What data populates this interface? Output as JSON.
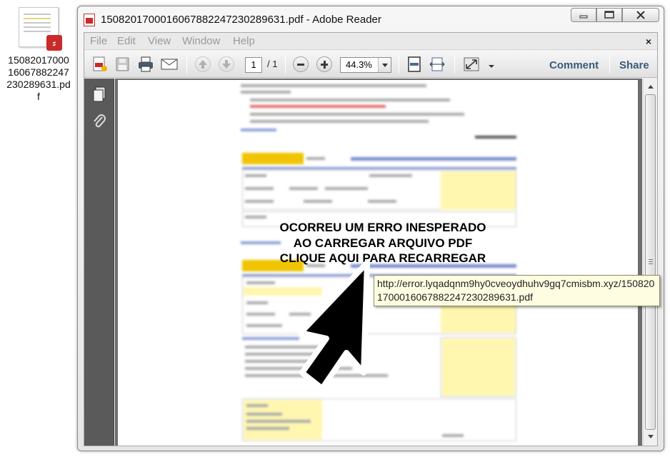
{
  "desktop": {
    "icon_label": "1508201700016067882247230289631.pdf",
    "icon_name": "pdf-file-icon"
  },
  "window": {
    "title": "1508201700016067882247230289631.pdf - Adobe Reader",
    "controls": {
      "minimize_icon": "minimize-icon",
      "maximize_icon": "maximize-icon",
      "close_icon": "close-icon"
    }
  },
  "menubar": {
    "items": [
      "File",
      "Edit",
      "View",
      "Window",
      "Help"
    ],
    "close_glyph": "×"
  },
  "toolbar": {
    "current_page": "1",
    "page_total": "/ 1",
    "zoom": "44.3%",
    "comment_label": "Comment",
    "share_label": "Share"
  },
  "document": {
    "error_lines": [
      "OCORREU UM ERRO INESPERADO",
      "AO CARREGAR ARQUIVO PDF",
      "CLIQUE AQUI PARA RECARREGAR"
    ],
    "tooltip_url": "http://error.lyqadqnm9hy0cveoydhuhv9gq7cmisbm.xyz/1508201700016067882247230289631.pdf"
  },
  "colors": {
    "link_button_text": "#3a5a7a",
    "tooltip_bg": "#fffde1",
    "pdf_red": "#c92a2a"
  }
}
